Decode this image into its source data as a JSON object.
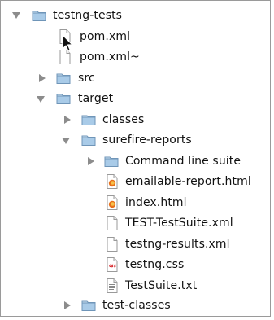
{
  "tree": {
    "items": [
      {
        "label": "testng-tests",
        "type": "folder",
        "expanded": true
      },
      {
        "label": "pom.xml",
        "type": "file",
        "icon": "blank-document-icon"
      },
      {
        "label": "pom.xml~",
        "type": "file",
        "icon": "blank-document-icon"
      },
      {
        "label": "src",
        "type": "folder",
        "expanded": false
      },
      {
        "label": "target",
        "type": "folder",
        "expanded": true
      },
      {
        "label": "classes",
        "type": "folder",
        "expanded": false
      },
      {
        "label": "surefire-reports",
        "type": "folder",
        "expanded": true
      },
      {
        "label": "Command line suite",
        "type": "folder",
        "expanded": false
      },
      {
        "label": "emailable-report.html",
        "type": "file",
        "icon": "html-document-icon"
      },
      {
        "label": "index.html",
        "type": "file",
        "icon": "html-document-icon"
      },
      {
        "label": "TEST-TestSuite.xml",
        "type": "file",
        "icon": "blank-document-icon"
      },
      {
        "label": "testng-results.xml",
        "type": "file",
        "icon": "blank-document-icon"
      },
      {
        "label": "testng.css",
        "type": "file",
        "icon": "css-document-icon"
      },
      {
        "label": "TestSuite.txt",
        "type": "file",
        "icon": "text-document-icon"
      },
      {
        "label": "test-classes",
        "type": "folder",
        "expanded": false
      }
    ]
  },
  "colors": {
    "folder_light": "#cde4f5",
    "folder_dark": "#8fb5d6",
    "folder_edge": "#6f95b8",
    "triangle": "#8c8c8c",
    "frame_border": "#9a9a9a"
  }
}
